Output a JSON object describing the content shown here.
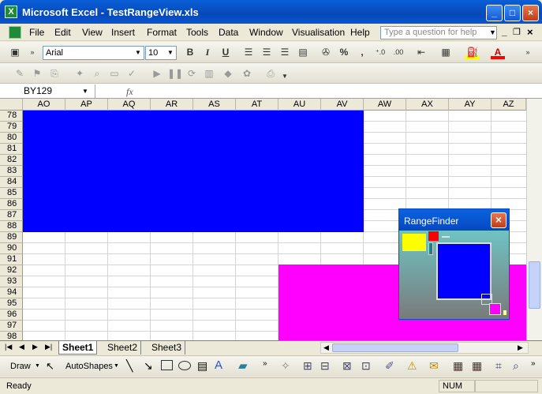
{
  "window": {
    "title": "Microsoft Excel - TestRangeView.xls",
    "app_icon": "X",
    "minimize": "_",
    "maximize": "□",
    "close": "×"
  },
  "menu": [
    "File",
    "Edit",
    "View",
    "Insert",
    "Format",
    "Tools",
    "Data",
    "Window",
    "Visualisation",
    "Help"
  ],
  "help_box": {
    "placeholder": "Type a question for help"
  },
  "font_combo": {
    "value": "Arial"
  },
  "size_combo": {
    "value": "10"
  },
  "format": {
    "bold": "B",
    "italic": "I",
    "underline": "U",
    "percent": "%",
    "comma": ","
  },
  "name_box": {
    "value": "BY129"
  },
  "fx": "fx",
  "columns": [
    "AO",
    "AP",
    "AQ",
    "AR",
    "AS",
    "AT",
    "AU",
    "AV",
    "AW",
    "AX",
    "AY",
    "AZ"
  ],
  "rows": [
    "78",
    "79",
    "80",
    "81",
    "82",
    "83",
    "84",
    "85",
    "86",
    "87",
    "88",
    "89",
    "90",
    "91",
    "92",
    "93",
    "94",
    "95",
    "96",
    "97",
    "98"
  ],
  "colors": {
    "blue_range": "#0000ff",
    "magenta_range": "#ff00ff",
    "yellow": "#ffff00",
    "red": "#ff0000",
    "teal": "#208080"
  },
  "sheets": [
    "Sheet1",
    "Sheet2",
    "Sheet3"
  ],
  "active_sheet": "Sheet1",
  "drawbar": {
    "draw_label": "Draw",
    "autoshapes_label": "AutoShapes"
  },
  "status": {
    "ready": "Ready",
    "num": "NUM"
  },
  "rangefinder": {
    "title": "RangeFinder",
    "close": "×"
  }
}
